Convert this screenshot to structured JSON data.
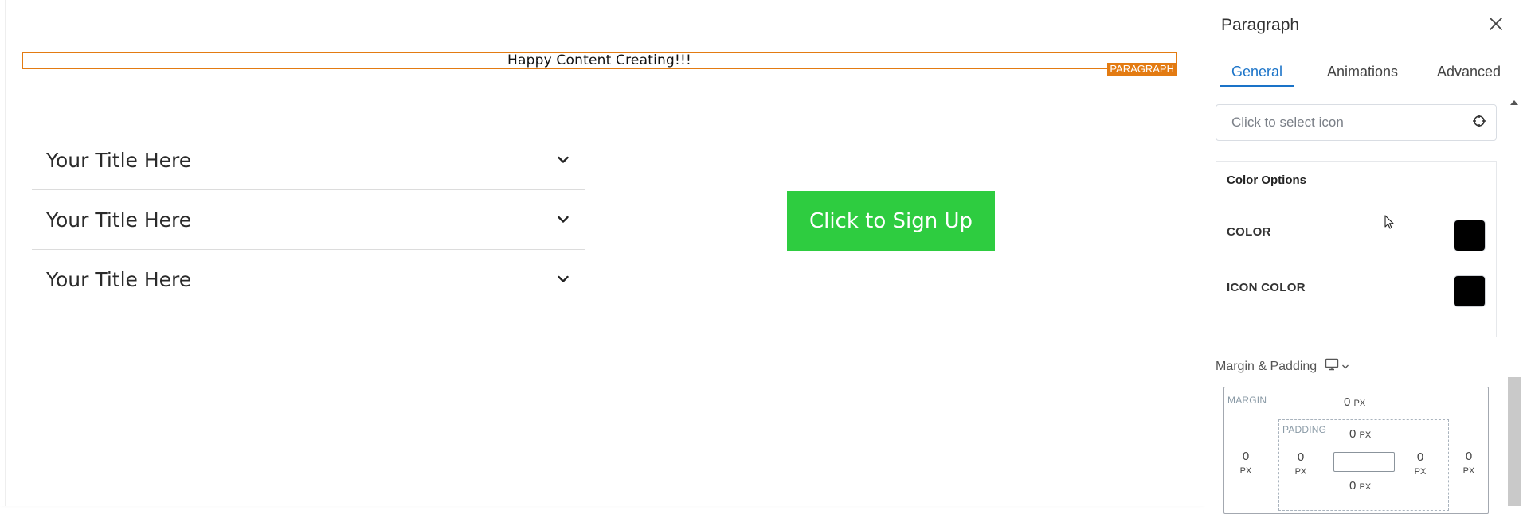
{
  "canvas": {
    "paragraph": {
      "text": "Happy Content Creating!!!",
      "tag": "PARAGRAPH"
    },
    "accordion": {
      "items": [
        {
          "title": "Your Title Here"
        },
        {
          "title": "Your Title Here"
        },
        {
          "title": "Your Title Here"
        }
      ]
    },
    "button": {
      "label": "Click to Sign Up",
      "color": "#2ecc40"
    }
  },
  "panel": {
    "title": "Paragraph",
    "tabs": [
      {
        "label": "General",
        "active": true
      },
      {
        "label": "Animations",
        "active": false
      },
      {
        "label": "Advanced",
        "active": false
      }
    ],
    "icon_field": {
      "placeholder": "Click to select icon",
      "icon": "crosshair-icon"
    },
    "color_options": {
      "title": "Color Options",
      "rows": [
        {
          "label": "COLOR",
          "value": "#000000"
        },
        {
          "label": "ICON COLOR",
          "value": "#000000"
        }
      ]
    },
    "margin_padding": {
      "label": "Margin & Padding",
      "device_icon": "desktop-icon",
      "margin_label": "MARGIN",
      "padding_label": "PADDING",
      "unit": "PX",
      "margin": {
        "top": "0",
        "right": "0",
        "bottom": "",
        "left": "0"
      },
      "padding": {
        "top": "0",
        "right": "0",
        "bottom": "0",
        "left": "0"
      }
    }
  },
  "colors": {
    "accent": "#1a73c8",
    "selection": "#e37b12"
  }
}
